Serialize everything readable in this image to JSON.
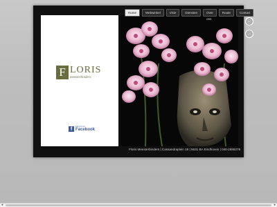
{
  "logo": {
    "mark": "F",
    "name": "LORIS",
    "sub": "meesterbinders"
  },
  "facebook": {
    "small": "Find us on",
    "big": "Facebook",
    "icon": "f"
  },
  "nav": [
    {
      "label": "Home",
      "active": true
    },
    {
      "label": "Webwinkel"
    },
    {
      "label": "Visie"
    },
    {
      "label": "Diensten"
    },
    {
      "label": "Over ons"
    },
    {
      "label": "Route"
    },
    {
      "label": "Contact"
    }
  ],
  "footer": "Floris Meesterbinders | Cassandraplein 19 | 5631 BA Eindhoven | 040-2858276",
  "side_icons": [
    {
      "icon": "←"
    },
    {
      "icon": "→"
    }
  ],
  "colors": {
    "brand": "#6a6e3c",
    "facebook": "#3b5998",
    "frame": "#101010"
  }
}
